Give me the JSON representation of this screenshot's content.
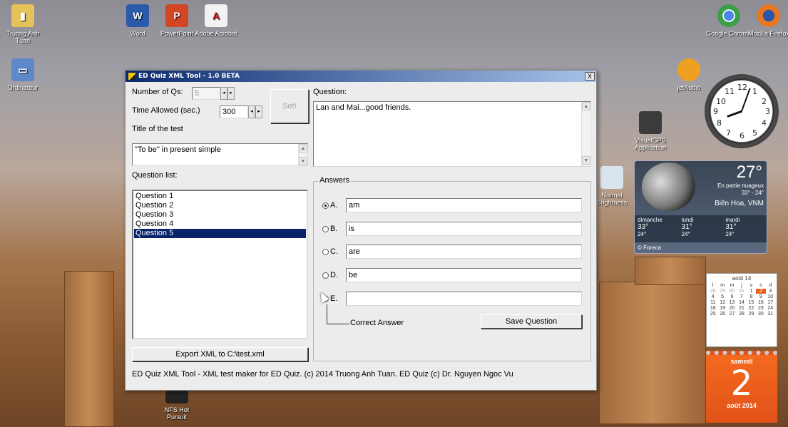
{
  "desktop": {
    "icons": [
      {
        "label": "Truong Anh Tuan",
        "icon": "user-folder-icon",
        "color": "#e6c25a"
      },
      {
        "label": "Ordinateur",
        "icon": "computer-icon",
        "color": "#5d89c8"
      },
      {
        "label": "Word",
        "icon": "word-icon",
        "color": "#2b5aa8"
      },
      {
        "label": "PowerPoint",
        "icon": "powerpoint-icon",
        "color": "#d24625"
      },
      {
        "label": "Adobe Acrobat",
        "icon": "acrobat-icon",
        "color": "#e0e0e0"
      },
      {
        "label": "Google Chrome",
        "icon": "chrome-icon",
        "color": "#3a9f49"
      },
      {
        "label": "Mozilla Firefox",
        "icon": "firefox-icon",
        "color": "#e8771f"
      },
      {
        "label": "jetAudio",
        "icon": "jetaudio-icon",
        "color": "#f0a020"
      },
      {
        "label": "VisualGPS Application",
        "icon": "visualgps-icon",
        "color": "#3b3b3b"
      },
      {
        "label": "Normal Brightness",
        "icon": "brightness-icon",
        "color": "#d9e4ee"
      },
      {
        "label": "NFS Hot Pursuit",
        "icon": "nfs-icon",
        "color": "#222222"
      }
    ]
  },
  "window": {
    "title": "ED Quiz XML Tool - 1.0 BETA",
    "close_label": "X",
    "number_of_qs_label": "Number of Qs:",
    "number_of_qs_value": "5",
    "time_allowed_label": "Time Allowed (sec.)",
    "time_allowed_value": "300",
    "set_button": "Set!",
    "title_of_test_label": "Title of the test",
    "title_of_test_value": "\"To be\" in present simple",
    "question_label": "Question:",
    "question_value": "Lan and Mai...good friends.",
    "question_list_label": "Question list:",
    "question_list": [
      "Question 1",
      "Question 2",
      "Question 3",
      "Question 4",
      "Question 5"
    ],
    "selected_question": 4,
    "answers_label": "Answers",
    "answers": [
      {
        "letter": "A.",
        "value": "am",
        "checked": true
      },
      {
        "letter": "B.",
        "value": "is",
        "checked": false
      },
      {
        "letter": "C.",
        "value": "are",
        "checked": false
      },
      {
        "letter": "D.",
        "value": "be",
        "checked": false
      },
      {
        "letter": "E.",
        "value": "",
        "checked": false
      }
    ],
    "correct_answer_label": "Correct Answer",
    "save_question_button": "Save Question",
    "export_button": "Export XML to C:\\test.xml",
    "footer_text": "ED Quiz XML Tool - XML test maker for ED Quiz. (c) 2014 Truong Anh Tuan. ED Quiz (c) Dr. Nguyen Ngoc Vu"
  },
  "clock": {
    "numbers": [
      "12",
      "1",
      "2",
      "3",
      "4",
      "5",
      "6",
      "7",
      "8",
      "9",
      "10",
      "11"
    ]
  },
  "weather": {
    "temp": "27°",
    "condition": "En partie nuageux",
    "range": "33° - 24°",
    "location": "Biên Hoa, VNM",
    "days": [
      {
        "name": "dimanche",
        "high": "33°",
        "low": "24°"
      },
      {
        "name": "lundi",
        "high": "31°",
        "low": "24°"
      },
      {
        "name": "mardi",
        "high": "31°",
        "low": "24°"
      }
    ],
    "credit": "© Foreca"
  },
  "calendar": {
    "month": "août 14",
    "weekdays": [
      "l",
      "m",
      "m",
      "j",
      "v",
      "s",
      "d"
    ],
    "days": [
      "28",
      "29",
      "30",
      "31",
      "1",
      "2",
      "3",
      "4",
      "5",
      "6",
      "7",
      "8",
      "9",
      "10",
      "11",
      "12",
      "13",
      "14",
      "15",
      "16",
      "17",
      "18",
      "19",
      "20",
      "21",
      "22",
      "23",
      "24",
      "25",
      "26",
      "27",
      "28",
      "29",
      "30",
      "31"
    ],
    "dim_count": 4,
    "today_index": 5,
    "day_name": "samedi",
    "day_number": "2",
    "month_year": "août 2014"
  }
}
